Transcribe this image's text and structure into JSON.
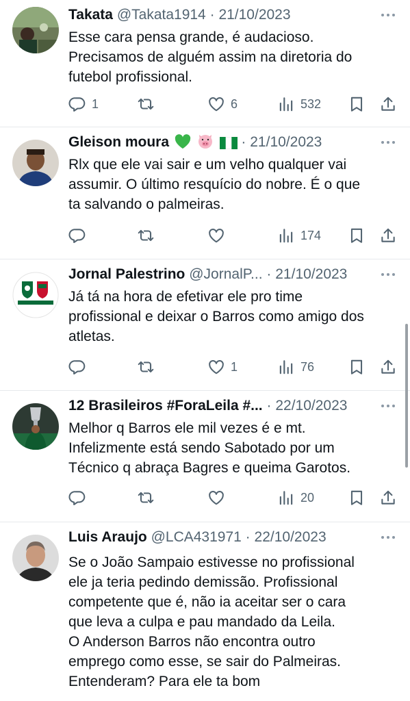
{
  "tweets": [
    {
      "name": "Takata",
      "handle": "@Takata1914",
      "date": "21/10/2023",
      "lines": [
        "Esse cara pensa grande, é audacioso.",
        "Precisamos de alguém assim na diretoria do",
        "futebol profissional."
      ],
      "replies": "1",
      "retweets": "",
      "likes": "6",
      "views": "532"
    },
    {
      "name": "Gleison moura",
      "handle": "",
      "date": "21/10/2023",
      "emojis": [
        "green-heart",
        "pig-face",
        "nigeria-flag"
      ],
      "lines": [
        "Rlx que ele vai sair e um velho qualquer vai",
        "assumir.  O último resquício do nobre. É o que",
        "ta salvando o palmeiras."
      ],
      "replies": "",
      "retweets": "",
      "likes": "",
      "views": "174"
    },
    {
      "name": "Jornal Palestrino",
      "handle": "@JornalP...",
      "date": "21/10/2023",
      "lines": [
        "Já tá na hora de efetivar ele pro time",
        "profissional e deixar o Barros como amigo dos",
        "atletas."
      ],
      "replies": "",
      "retweets": "",
      "likes": "1",
      "views": "76"
    },
    {
      "name": "12 Brasileiros #ForaLeila #...",
      "handle": "",
      "date": "22/10/2023",
      "lines": [
        "Melhor q Barros ele mil vezes é e mt.",
        "Infelizmente está sendo Sabotado por um",
        "Técnico q abraça Bagres e queima Garotos."
      ],
      "replies": "",
      "retweets": "",
      "likes": "",
      "views": "20"
    },
    {
      "name": "Luis Araujo",
      "handle": "@LCA431971",
      "date": "22/10/2023",
      "lines": [
        "Se o João Sampaio estivesse no profissional",
        "ele ja teria pedindo demissão. Profissional",
        "competente que é, não ia aceitar ser o cara",
        "que leva a culpa e pau mandado da Leila.",
        "O Anderson Barros não encontra outro",
        "emprego como esse, se sair do Palmeiras.",
        "Entenderam? Para ele ta bom"
      ]
    }
  ],
  "separator": "·",
  "colors": {
    "text": "#0f1419",
    "secondary": "#536471",
    "divider": "#e6e9ec"
  },
  "icons": [
    "reply-icon",
    "retweet-icon",
    "like-icon",
    "views-icon",
    "bookmark-icon",
    "share-icon",
    "more-icon"
  ]
}
